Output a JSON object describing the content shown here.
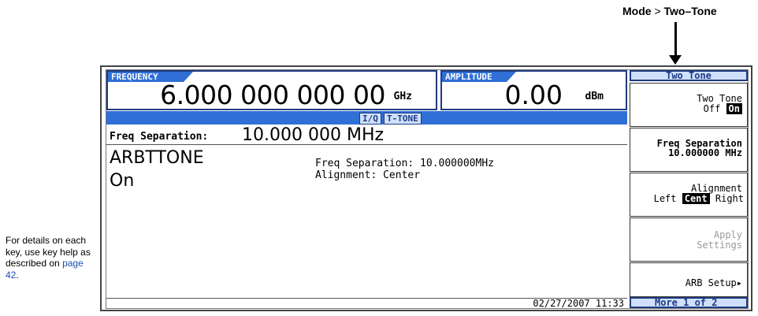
{
  "annotation": {
    "mode_label": "Mode",
    "separator": ">",
    "mode_target": "Two–Tone"
  },
  "side_note": {
    "text": "For details on each key, use key help as described on",
    "link": "page 42",
    "suffix": "."
  },
  "frequency": {
    "header": "FREQUENCY",
    "value": "6.000 000 000 00",
    "unit": "GHz"
  },
  "amplitude": {
    "header": "AMPLITUDE",
    "value": "0.00",
    "unit": "dBm"
  },
  "status": {
    "iq": "I/Q",
    "ttone": "T-TONE"
  },
  "freq_separation": {
    "label": "Freq Separation:",
    "value": "10.000 000 MHz"
  },
  "main": {
    "title": "ARBTTONE",
    "state": "On",
    "info_line1": "Freq Separation: 10.000000MHz",
    "info_line2": "Alignment: Center"
  },
  "bottom": {
    "datetime": "02/27/2007 11:33"
  },
  "softkeys": {
    "menu_title": "Two Tone",
    "two_tone": {
      "line1": "Two Tone",
      "off": "Off",
      "on": "On"
    },
    "freq_sep": {
      "line1": "Freq Separation",
      "line2": "10.000000 MHz"
    },
    "alignment": {
      "line1": "Alignment",
      "left": "Left",
      "cent": "Cent",
      "right": "Right"
    },
    "apply": {
      "line1": "Apply",
      "line2": "Settings"
    },
    "arb_setup": {
      "line1": "ARB Setup▸"
    },
    "more": "More 1 of 2"
  }
}
